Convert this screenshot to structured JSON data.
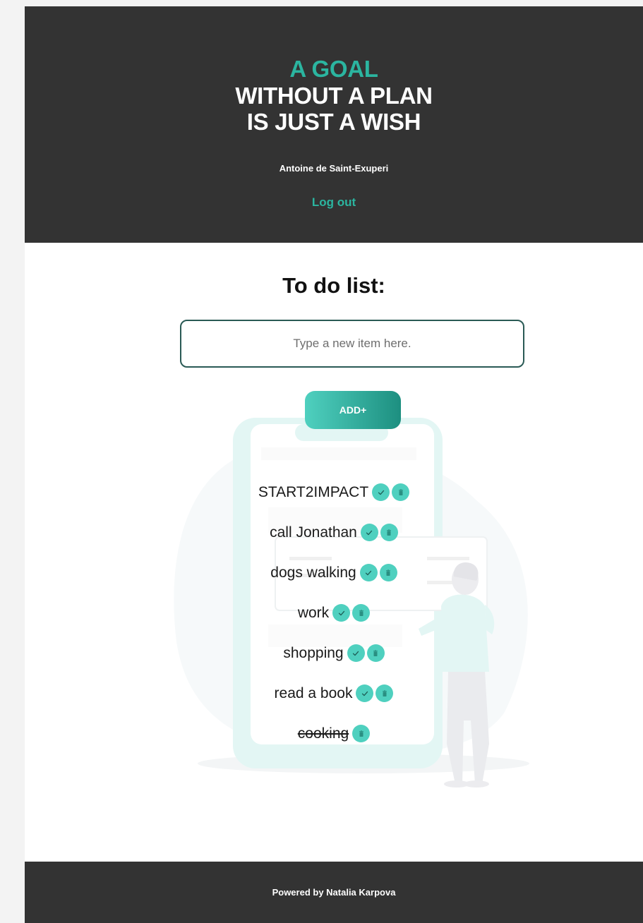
{
  "header": {
    "quote_line1": "A GOAL",
    "quote_line2": "WITHOUT A PLAN",
    "quote_line3": "IS JUST A WISH",
    "author": "Antoine de Saint-Exuperi",
    "logout_label": "Log out"
  },
  "main": {
    "title": "To do list:",
    "input_placeholder": "Type a new item here.",
    "input_value": "",
    "add_label": "ADD+"
  },
  "todos": [
    {
      "text": "START2IMPACT",
      "done": false
    },
    {
      "text": "call Jonathan",
      "done": false
    },
    {
      "text": "dogs walking",
      "done": false
    },
    {
      "text": "work",
      "done": false
    },
    {
      "text": "shopping",
      "done": false
    },
    {
      "text": "read a book",
      "done": false
    },
    {
      "text": "cooking",
      "done": true
    }
  ],
  "footer": {
    "text": "Powered by Natalia Karpova"
  },
  "icons": {
    "complete": "check-icon",
    "delete": "trash-icon"
  },
  "colors": {
    "accent": "#2bb5a0",
    "header_bg": "#333333",
    "icon_bg": "#4fd0bf"
  }
}
